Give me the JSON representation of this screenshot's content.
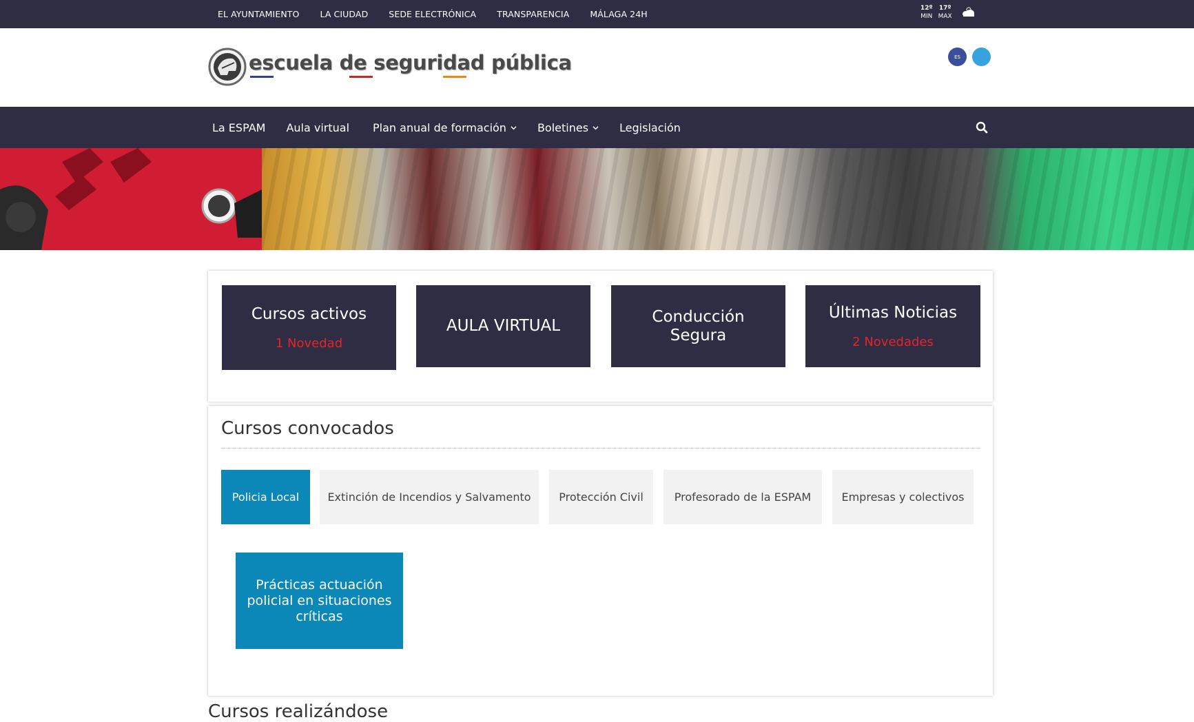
{
  "top_nav": {
    "links": [
      "EL AYUNTAMIENTO",
      "LA CIUDAD",
      "SEDE ELECTRÓNICA",
      "TRANSPARENCIA",
      "MÁLAGA 24H"
    ]
  },
  "weather": {
    "min_temp": "12º",
    "min_label": "MIN",
    "max_temp": "17º",
    "max_label": "MAX",
    "icon": "cloud-icon"
  },
  "brand": {
    "name": "escuela de seguridad pública"
  },
  "main_nav": {
    "items": [
      "La ESPAM",
      "Aula virtual",
      "Plan anual de formación",
      "Boletines",
      "Legislación"
    ]
  },
  "tiles": [
    {
      "title": "Cursos activos",
      "subtitle": "1 Novedad"
    },
    {
      "title": "AULA VIRTUAL",
      "subtitle": ""
    },
    {
      "title": "Conducción Segura",
      "subtitle": ""
    },
    {
      "title": "Últimas Noticias",
      "subtitle": "2 Novedades"
    }
  ],
  "courses": {
    "title": "Cursos convocados",
    "tabs": [
      "Policia Local",
      "Extinción de Incendios y Salvamento",
      "Protección Civil",
      "Profesorado de la ESPAM",
      "Empresas y colectivos"
    ],
    "active_tab": "Policia Local",
    "cards": [
      "Prácticas actuación policial en situaciones críticas"
    ]
  },
  "next_section": {
    "title": "Cursos realizándose"
  },
  "colors": {
    "navy": "#2e2d43",
    "accent_blue": "#0b87b8",
    "novelty_red": "#e6252b",
    "tab_bg": "#f2f2f2"
  }
}
